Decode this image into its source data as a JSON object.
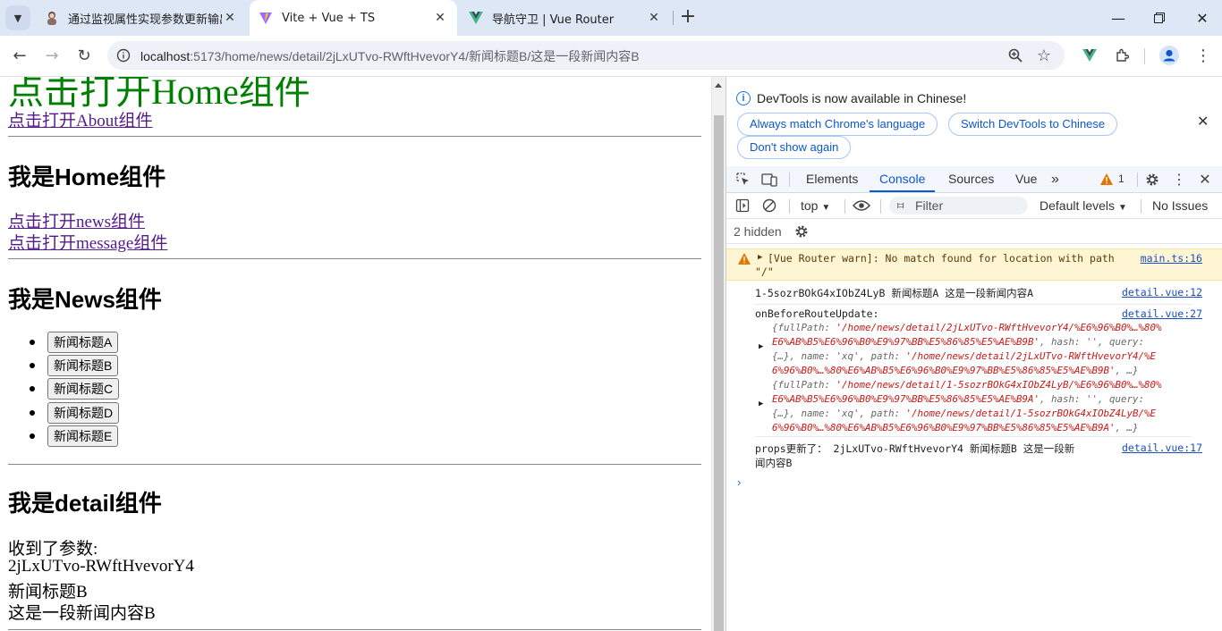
{
  "tabs": [
    {
      "title": "通过监视属性实现参数更新输出",
      "active": false
    },
    {
      "title": "Vite + Vue + TS",
      "active": true
    },
    {
      "title": "导航守卫 | Vue Router",
      "active": false
    }
  ],
  "address": {
    "host": "localhost",
    "rest": ":5173/home/news/detail/2jLxUTvo-RWftHvevorY4/新闻标题B/这是一段新闻内容B"
  },
  "page": {
    "top_link_partial": "点击打开Home组件",
    "about_link": "点击打开About组件",
    "home_heading": "我是Home组件",
    "news_link": "点击打开news组件",
    "message_link": "点击打开message组件",
    "news_heading": "我是News组件",
    "news_buttons": [
      "新闻标题A",
      "新闻标题B",
      "新闻标题C",
      "新闻标题D",
      "新闻标题E"
    ],
    "detail_heading": "我是detail组件",
    "received_label": "收到了参数:",
    "param_id": "2jLxUTvo-RWftHvevorY4",
    "param_title": "新闻标题B",
    "param_content": "这是一段新闻内容B"
  },
  "devtools": {
    "info_message": "DevTools is now available in Chinese!",
    "btn_match": "Always match Chrome's language",
    "btn_switch": "Switch DevTools to Chinese",
    "btn_dont_show": "Don't show again",
    "tabs": [
      "Elements",
      "Console",
      "Sources",
      "Vue"
    ],
    "active_tab": "Console",
    "warning_count": "1",
    "context": "top",
    "filter_placeholder": "Filter",
    "levels": "Default levels",
    "issues": "No Issues",
    "hidden": "2 hidden",
    "messages": {
      "warn_text": "[Vue Router warn]: No match found for location with path",
      "warn_path": "\"/\"",
      "warn_src": "main.ts:16",
      "log1_text": "1-5sozrBOkG4xIObZ4LyB 新闻标题A 这是一段新闻内容A",
      "log1_src": "detail.vue:12",
      "log2_label": "onBeforeRouteUpdate:",
      "log2_src": "detail.vue:27",
      "obj1_l1a": "{fullPath: ",
      "obj1_l1b": "'/home/news/detail/2jLxUTvo-RWftHvevorY4/%E6%96%B0%…%80%",
      "obj1_l2a": "E6%AB%B5%E6%96%B0%E9%97%BB%E5%86%85%E5%AE%B9B'",
      "obj1_l2b": ", hash: '', query:",
      "obj1_l3a": "{…}, name: 'xq', path: ",
      "obj1_l3b": "'/home/news/detail/2jLxUTvo-RWftHvevorY4/%E",
      "obj1_l4a": "6%96%B0%…%80%E6%AB%B5%E6%96%B0%E9%97%BB%E5%86%85%E5%AE%B9B'",
      "obj1_l4b": ",  …}",
      "obj2_l1a": "{fullPath: ",
      "obj2_l1b": "'/home/news/detail/1-5sozrBOkG4xIObZ4LyB/%E6%96%B0%…%80%",
      "obj2_l2a": "E6%AB%B5%E6%96%B0%E9%97%BB%E5%86%85%E5%AE%B9A'",
      "obj2_l2b": ", hash: '', query:",
      "obj2_l3a": "{…}, name: 'xq', path: ",
      "obj2_l3b": "'/home/news/detail/1-5sozrBOkG4xIObZ4LyB/%E",
      "obj2_l4a": "6%96%B0%…%80%E6%AB%B5%E6%96%B0%E9%97%BB%E5%86%85%E5%AE%B9A'",
      "obj2_l4b": ",  …}",
      "log3_l1": "props更新了： 2jLxUTvo-RWftHvevorY4 新闻标题B 这是一段新",
      "log3_l2": "闻内容B",
      "log3_src": "detail.vue:17"
    }
  },
  "colors": {
    "tabstrip": "#dee7f5",
    "accent": "#0b57d0",
    "router_link_active": "#008000",
    "visited_link": "#551a8b"
  }
}
